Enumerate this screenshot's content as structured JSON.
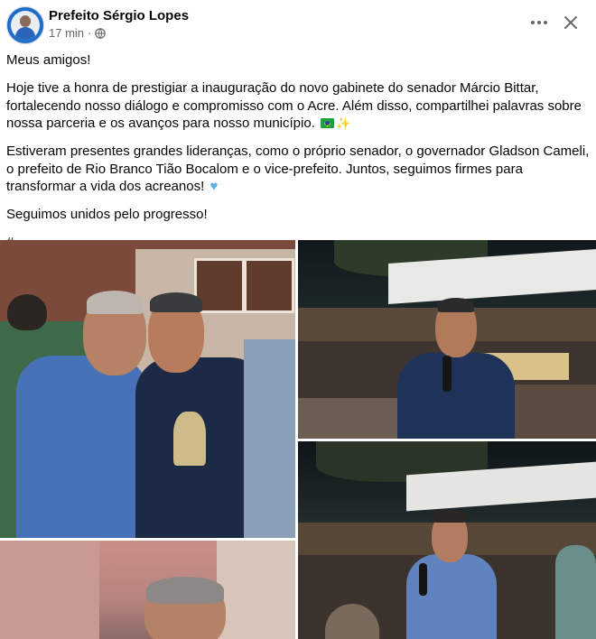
{
  "post": {
    "author": "Prefeito Sérgio Lopes",
    "time": "17 min",
    "separator": "·",
    "privacy_icon": "globe-icon",
    "more_icon": "more-horizontal-icon",
    "close_icon": "close-icon"
  },
  "body": {
    "p1": "Meus amigos!",
    "p2": "Hoje tive a honra de prestigiar a inauguração do novo gabinete do senador Márcio Bittar, fortalecendo nosso diálogo e compromisso com o Acre. Além disso, compartilhei palavras sobre nossa parceria e os avanços para nosso município.",
    "p3": "Estiveram presentes grandes lideranças, como o próprio senador, o governador Gladson Cameli, o prefeito de Rio Branco Tião Bocalom e o vice-prefeito. Juntos, seguimos firmes para transformar a vida dos acreanos!",
    "p4": "Seguimos unidos pelo progresso!",
    "p5": "#"
  },
  "photos": {
    "count": 4
  },
  "colors": {
    "name": "#050505",
    "meta": "#65676b",
    "accent_heart": "#5aaeea"
  }
}
